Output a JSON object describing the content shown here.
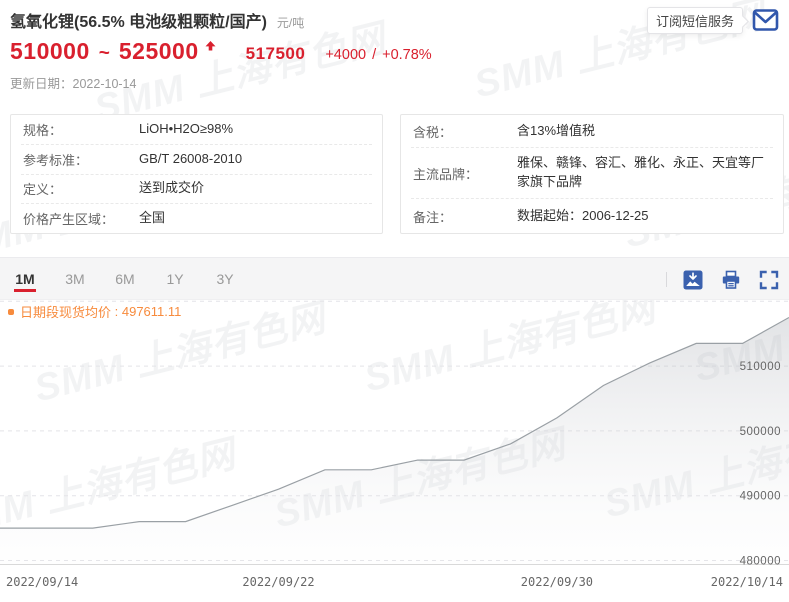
{
  "colors": {
    "red": "#d9202e",
    "blue": "#3b61ae",
    "orange": "#f78b3d",
    "line": "#9aa0a5",
    "grid": "#e4e4e8",
    "axis": "#d9d9d9"
  },
  "header": {
    "title": "氢氧化锂(56.5% 电池级粗颗粒/国产)",
    "unit": "元/吨",
    "price_low": "510000",
    "price_tilde": "~",
    "price_high": "525000",
    "price_mid": "517500",
    "change_value": "+4000",
    "change_sep": "/",
    "change_pct": "+0.78%",
    "update_label": "更新日期：",
    "update_value": "2022-10-14",
    "subscribe_label": "订阅短信服务"
  },
  "icons": [
    "mail-icon",
    "price-up-icon",
    "save-image-icon",
    "print-icon",
    "fullscreen-icon"
  ],
  "info_left": {
    "rows": [
      {
        "label": "规格：",
        "value": "LiOH•H2O≥98%"
      },
      {
        "label": "参考标准：",
        "value": "GB/T 26008-2010"
      },
      {
        "label": "定义：",
        "value": "送到成交价"
      },
      {
        "label": "价格产生区域：",
        "value": "全国"
      }
    ]
  },
  "info_right": {
    "rows": [
      {
        "label": "含税：",
        "value": "含13%增值税"
      },
      {
        "label": "主流品牌：",
        "value": "雅保、赣锋、容汇、雅化、永正、天宜等厂家旗下品牌"
      },
      {
        "label": "备注：",
        "value": "数据起始：2006-12-25"
      }
    ]
  },
  "tabs": {
    "items": [
      {
        "label": "1M",
        "active": true
      },
      {
        "label": "3M",
        "active": false
      },
      {
        "label": "6M",
        "active": false
      },
      {
        "label": "1Y",
        "active": false
      },
      {
        "label": "3Y",
        "active": false
      }
    ]
  },
  "watermark": {
    "text": "SMM 上海有色网"
  },
  "chart_data": {
    "type": "area",
    "legend": "日期段现货均价",
    "legend_value": "497611.11",
    "legend_position": "top-left",
    "y_axis_position": "right",
    "grid": "dashed-horizontal",
    "x": [
      "2022/09/14",
      "2022/09/15",
      "2022/09/16",
      "2022/09/19",
      "2022/09/20",
      "2022/09/21",
      "2022/09/22",
      "2022/09/23",
      "2022/09/26",
      "2022/09/27",
      "2022/09/28",
      "2022/09/29",
      "2022/09/30",
      "2022/10/10",
      "2022/10/11",
      "2022/10/12",
      "2022/10/13",
      "2022/10/14"
    ],
    "values": [
      485000,
      485000,
      485000,
      486000,
      486000,
      488500,
      491000,
      494000,
      494000,
      495500,
      495500,
      498000,
      502000,
      507000,
      510500,
      513500,
      513500,
      517500
    ],
    "x_ticks": [
      {
        "label": "2022/09/14",
        "index": 0
      },
      {
        "label": "2022/09/22",
        "index": 6
      },
      {
        "label": "2022/09/30",
        "index": 12
      },
      {
        "label": "2022/10/14",
        "index": 17
      }
    ],
    "y_ticks": [
      510000,
      500000,
      490000,
      480000
    ],
    "y_top_gridline": 520000,
    "ylim": [
      480000,
      520000
    ]
  }
}
